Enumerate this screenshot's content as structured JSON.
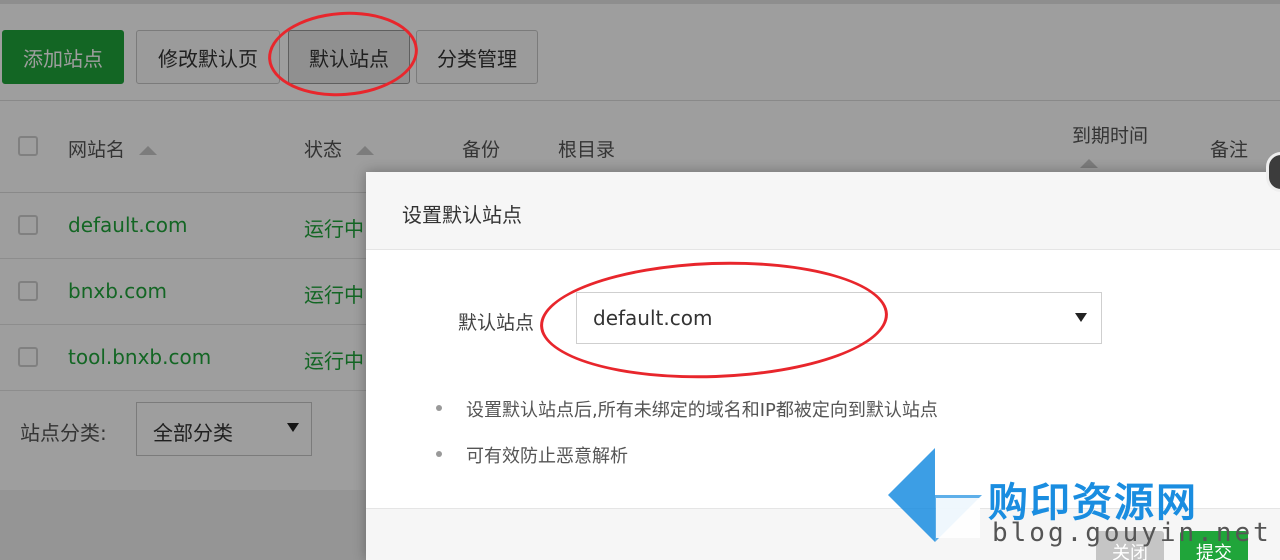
{
  "toolbar": {
    "add_site": "添加站点",
    "edit_default_page": "修改默认页",
    "default_site": "默认站点",
    "category_manage": "分类管理"
  },
  "table": {
    "headers": {
      "site_name": "网站名",
      "status": "状态",
      "backup": "备份",
      "root_dir": "根目录",
      "expire_time": "到期时间",
      "remark": "备注"
    },
    "rows": [
      {
        "name": "default.com",
        "status": "运行中"
      },
      {
        "name": "bnxb.com",
        "status": "运行中"
      },
      {
        "name": "tool.bnxb.com",
        "status": "运行中"
      }
    ]
  },
  "category": {
    "label": "站点分类:",
    "selected": "全部分类"
  },
  "modal": {
    "title": "设置默认站点",
    "field_label": "默认站点",
    "selected_site": "default.com",
    "tips": [
      "设置默认站点后,所有未绑定的域名和IP都被定向到默认站点",
      "可有效防止恶意解析"
    ],
    "close_label": "关闭",
    "submit_label": "提交"
  },
  "watermark": {
    "brand": "购印资源网",
    "url": "blog.gouyin.net"
  },
  "colors": {
    "accent_green": "#20a53a",
    "annotation_red": "#e8262c",
    "watermark_blue": "#1a8de0"
  }
}
